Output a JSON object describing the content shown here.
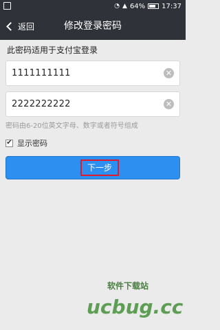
{
  "status_bar": {
    "battery_percent": "64%",
    "time": "17:37"
  },
  "title_bar": {
    "back_label": "返回",
    "title": "修改登录密码"
  },
  "form": {
    "applies_hint": "此密码适用于支付宝登录",
    "password_1": "1111111111",
    "password_2": "2222222222",
    "rule_hint": "密码由6-20位英文字母、数字或者符号组成",
    "show_password_label": "显示密码",
    "show_password_checked": true,
    "next_label": "下一步"
  },
  "watermark": {
    "tagline": "软件下载站",
    "logo": "ucbug.cc"
  },
  "colors": {
    "bar_bg": "#2f3238",
    "button_blue": "#2d8ff0",
    "highlight_red": "#e11a2b"
  }
}
